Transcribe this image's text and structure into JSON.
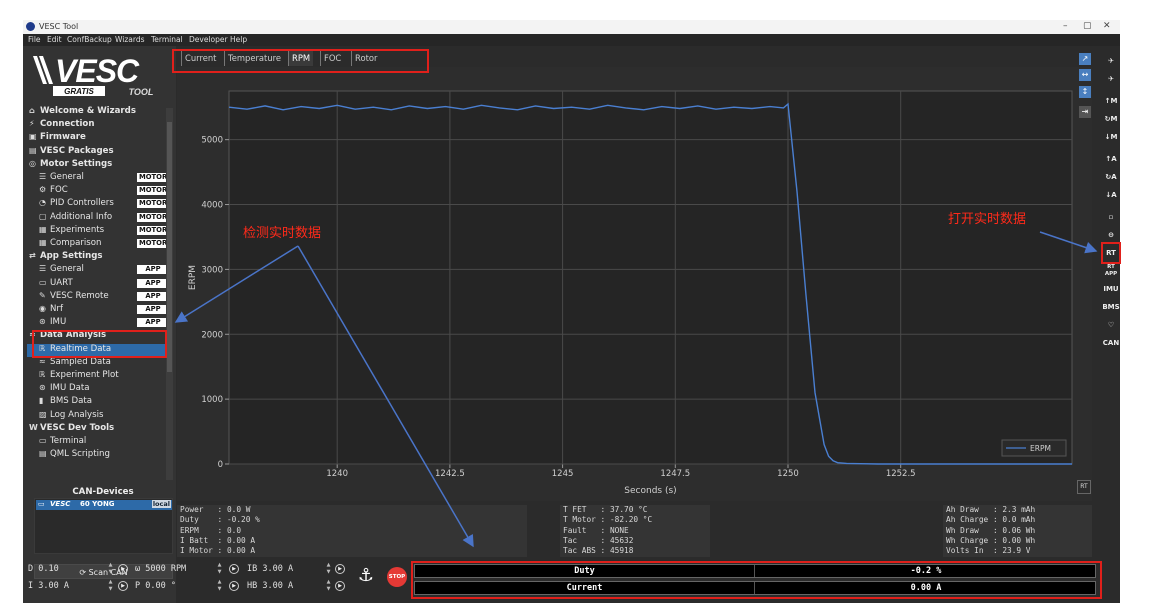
{
  "window": {
    "title": "VESC Tool",
    "controls": [
      "–",
      "▢",
      "✕"
    ]
  },
  "menu": [
    "File",
    "Edit",
    "ConfBackup",
    "Wizards",
    "Terminal",
    "Developer",
    "Help"
  ],
  "brand": {
    "logo_text": "VESC",
    "tag_left": "GRATIS",
    "tag_right": "TOOL"
  },
  "nav": [
    {
      "label": "Welcome & Wizards",
      "icon": "home-icon",
      "glyph": "⌂",
      "header": true
    },
    {
      "label": "Connection",
      "icon": "plug-icon",
      "glyph": "⚡",
      "header": true
    },
    {
      "label": "Firmware",
      "icon": "chip-icon",
      "glyph": "▣",
      "header": true
    },
    {
      "label": "VESC Packages",
      "icon": "package-icon",
      "glyph": "▤",
      "header": true
    },
    {
      "label": "Motor Settings",
      "icon": "motor-icon",
      "glyph": "◎",
      "header": true
    },
    {
      "label": "General",
      "icon": "sliders-icon",
      "glyph": "☰",
      "badge": "MOTOR"
    },
    {
      "label": "FOC",
      "icon": "foc-icon",
      "glyph": "⚙",
      "badge": "MOTOR"
    },
    {
      "label": "PID Controllers",
      "icon": "gauge-icon",
      "glyph": "◔",
      "badge": "MOTOR"
    },
    {
      "label": "Additional Info",
      "icon": "info-icon",
      "glyph": "▢",
      "badge": "MOTOR"
    },
    {
      "label": "Experiments",
      "icon": "calculator-icon",
      "glyph": "▦",
      "badge": "MOTOR"
    },
    {
      "label": "Comparison",
      "icon": "calculator-icon",
      "glyph": "▦",
      "badge": "MOTOR"
    },
    {
      "label": "App Settings",
      "icon": "swap-icon",
      "glyph": "⇄",
      "header": true
    },
    {
      "label": "General",
      "icon": "sliders-icon",
      "glyph": "☰",
      "badge": "APP"
    },
    {
      "label": "UART",
      "icon": "uart-icon",
      "glyph": "▭",
      "badge": "APP"
    },
    {
      "label": "VESC Remote",
      "icon": "remote-icon",
      "glyph": "✎",
      "badge": "APP"
    },
    {
      "label": "Nrf",
      "icon": "wireless-icon",
      "glyph": "◉",
      "badge": "APP"
    },
    {
      "label": "IMU",
      "icon": "imu-icon",
      "glyph": "⊛",
      "badge": "APP"
    },
    {
      "label": "Data Analysis",
      "icon": "analysis-icon",
      "glyph": "≈",
      "header": true
    },
    {
      "label": "Realtime Data",
      "icon": "rt-icon",
      "glyph": "ℝ",
      "selected": true
    },
    {
      "label": "Sampled Data",
      "icon": "wave-icon",
      "glyph": "≈"
    },
    {
      "label": "Experiment Plot",
      "icon": "plot-icon",
      "glyph": "ℝ"
    },
    {
      "label": "IMU Data",
      "icon": "imu-icon",
      "glyph": "⊛"
    },
    {
      "label": "BMS Data",
      "icon": "battery-icon",
      "glyph": "▮"
    },
    {
      "label": "Log Analysis",
      "icon": "log-icon",
      "glyph": "▨"
    },
    {
      "label": "VESC Dev Tools",
      "icon": "devtools-icon",
      "glyph": "W",
      "header": true
    },
    {
      "label": "Terminal",
      "icon": "terminal-icon",
      "glyph": "▭"
    },
    {
      "label": "QML Scripting",
      "icon": "script-icon",
      "glyph": "▤"
    }
  ],
  "can": {
    "title": "CAN-Devices",
    "device": "60 YONG",
    "device_brand": "VESC",
    "device_tag": "local",
    "scan_label": "Scan CAN"
  },
  "tabs": [
    "Current",
    "Temperature",
    "RPM",
    "FOC",
    "Rotor Position"
  ],
  "active_tab": "RPM",
  "right_tools": [
    "✈",
    "✈",
    "↑M",
    "↻M",
    "↓M",
    "↑A",
    "↻A",
    "↓A",
    "▫",
    "⊖",
    "RT",
    "RT APP",
    "IMU",
    "BMS",
    "♡",
    "CAN"
  ],
  "stats": {
    "left": "Power   : 0.0 W\nDuty    : -0.20 %\nERPM    : 0.0\nI Batt  : 0.00 A\nI Motor : 0.00 A",
    "middle": "T FET   : 37.70 °C\nT Motor : -82.20 °C\nFault   : NONE\nTac     : 45632\nTac ABS : 45918",
    "right": "Ah Draw   : 2.3 mAh\nAh Charge : 0.0 mAh\nWh Draw   : 0.06 Wh\nWh Charge : 0.00 Wh\nVolts In  : 23.9 V"
  },
  "controls": {
    "duty": "D 0.10",
    "current": "I 3.00 A",
    "rpm": "ω 5000 RPM",
    "pos": "P 0.00 °",
    "ib": "IB 3.00 A",
    "hb": "HB 3.00 A",
    "stop": "STOP"
  },
  "bars": [
    {
      "label": "Duty",
      "value": "-0.2 %"
    },
    {
      "label": "Current",
      "value": "0.00 A"
    }
  ],
  "annotations": {
    "left": "检测实时数据",
    "right": "打开实时数据"
  },
  "chart_data": {
    "type": "line",
    "title": "",
    "xlabel": "Seconds (s)",
    "ylabel": "ERPM",
    "xlim": [
      1237.6,
      1256.3
    ],
    "ylim": [
      0,
      5750
    ],
    "xticks": [
      1240,
      1242.5,
      1245,
      1247.5,
      1250,
      1252.5
    ],
    "xtick_labels": [
      "1240",
      "1242.5",
      "1245",
      "1247.5",
      "1250",
      "1252.5"
    ],
    "yticks": [
      0,
      1000,
      2000,
      3000,
      4000,
      5000
    ],
    "ytick_labels": [
      "0",
      "1000",
      "2000",
      "3000",
      "4000",
      "5000"
    ],
    "grid": true,
    "legend": "bottom-right",
    "line_color": "#4a7fd1",
    "series": [
      {
        "name": "ERPM",
        "x": [
          1237.6,
          1238.0,
          1238.4,
          1238.8,
          1239.2,
          1239.6,
          1240.0,
          1240.4,
          1240.8,
          1241.2,
          1241.6,
          1242.0,
          1242.4,
          1242.8,
          1243.2,
          1243.6,
          1244.0,
          1244.4,
          1244.8,
          1245.2,
          1245.6,
          1246.0,
          1246.4,
          1246.8,
          1247.2,
          1247.6,
          1248.0,
          1248.4,
          1248.8,
          1249.2,
          1249.6,
          1249.9,
          1250.0,
          1250.2,
          1250.4,
          1250.6,
          1250.8,
          1250.9,
          1251.0,
          1251.1,
          1251.3,
          1251.6,
          1252.0,
          1253.0,
          1254.0,
          1255.0,
          1256.3
        ],
        "y": [
          5500,
          5470,
          5520,
          5460,
          5510,
          5480,
          5530,
          5470,
          5500,
          5460,
          5520,
          5480,
          5510,
          5470,
          5530,
          5490,
          5460,
          5520,
          5480,
          5500,
          5470,
          5530,
          5490,
          5460,
          5510,
          5480,
          5520,
          5470,
          5500,
          5480,
          5510,
          5490,
          5550,
          4200,
          2600,
          1100,
          300,
          120,
          50,
          20,
          10,
          5,
          0,
          0,
          0,
          0,
          0
        ]
      }
    ]
  }
}
